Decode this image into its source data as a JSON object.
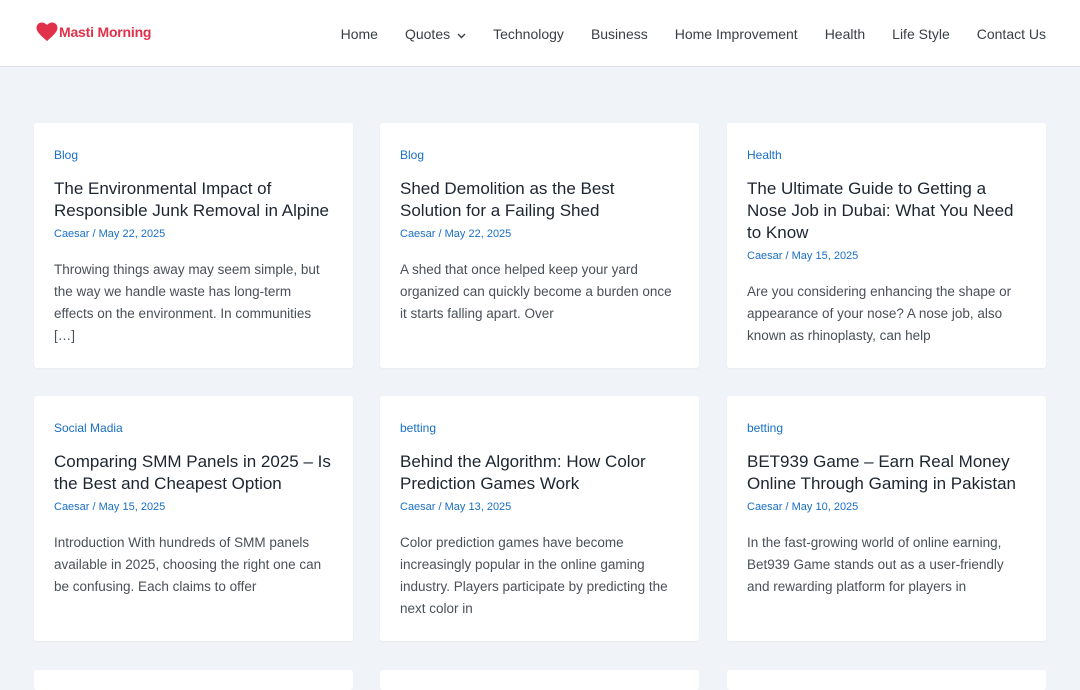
{
  "site": {
    "name": "Masti Morning",
    "brand_color": "#e0304a",
    "accent_color": "#1a6fc4"
  },
  "nav": {
    "items": [
      {
        "label": "Home"
      },
      {
        "label": "Quotes",
        "has_dropdown": true
      },
      {
        "label": "Technology"
      },
      {
        "label": "Business"
      },
      {
        "label": "Home Improvement"
      },
      {
        "label": "Health"
      },
      {
        "label": "Life Style"
      },
      {
        "label": "Contact Us"
      }
    ]
  },
  "posts": [
    {
      "category": "Blog",
      "title": "The Environmental Impact of Responsible Junk Removal in Alpine",
      "author": "Caesar",
      "date": "May 22, 2025",
      "excerpt": "Throwing things away may seem simple, but the way we handle waste has long-term effects on the environment. In communities […]"
    },
    {
      "category": "Blog",
      "title": "Shed Demolition as the Best Solution for a Failing Shed",
      "author": "Caesar",
      "date": "May 22, 2025",
      "excerpt": "A shed that once helped keep your yard organized can quickly become a burden once it starts falling apart. Over"
    },
    {
      "category": "Health",
      "title": "The Ultimate Guide to Getting a Nose Job in Dubai: What You Need to Know",
      "author": "Caesar",
      "date": "May 15, 2025",
      "excerpt": "Are you considering enhancing the shape or appearance of your nose? A nose job, also known as rhinoplasty, can help"
    },
    {
      "category": "Social Madia",
      "title": "Comparing SMM Panels in 2025 – Is the Best and Cheapest Option",
      "author": "Caesar",
      "date": "May 15, 2025",
      "excerpt": "Introduction With hundreds of SMM panels available in 2025, choosing the right one can be confusing. Each claims to offer"
    },
    {
      "category": "betting",
      "title": "Behind the Algorithm: How Color Prediction Games Work",
      "author": "Caesar",
      "date": "May 13, 2025",
      "excerpt": "Color prediction games have become increasingly popular in the online gaming industry. Players participate by predicting the next color in"
    },
    {
      "category": "betting",
      "title": "BET939 Game – Earn Real Money Online Through Gaming in Pakistan",
      "author": "Caesar",
      "date": "May 10, 2025",
      "excerpt": "In the fast-growing world of online earning, Bet939 Game stands out as a user-friendly and rewarding platform for players in"
    }
  ]
}
